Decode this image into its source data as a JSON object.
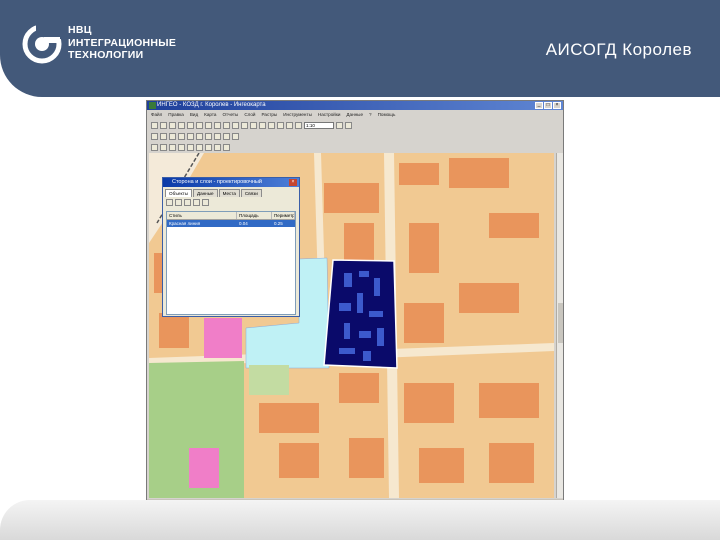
{
  "slide": {
    "title": "АИСОГД Королев",
    "logo": {
      "line1": "НВЦ",
      "line2": "ИНТЕГРАЦИОННЫЕ",
      "line3": "ТЕХНОЛОГИИ"
    }
  },
  "colors": {
    "header": "#43597a",
    "selected_parcel": "#0a0a6a",
    "map_base": "#f0c58f"
  },
  "app": {
    "title": "ИНГЕО - КОЗД г. Королев - Ингеокарта",
    "menu": [
      "Файл",
      "Правка",
      "Вид",
      "Карта",
      "Отчеты",
      "Слой",
      "Растры",
      "Инструменты",
      "Настройки",
      "Данные",
      "?",
      "Помощь"
    ],
    "scale_value": "1:10"
  },
  "dialog": {
    "title": "Сторона и слои - проектировочный",
    "tabs": [
      "Объекты",
      "Данные",
      "Места",
      "Связи"
    ],
    "columns": [
      "Стиль",
      "Площадь",
      "Периметр"
    ],
    "rows": [
      {
        "style": "Красная линия",
        "area": "0.04",
        "perimeter": "0.25"
      }
    ]
  }
}
